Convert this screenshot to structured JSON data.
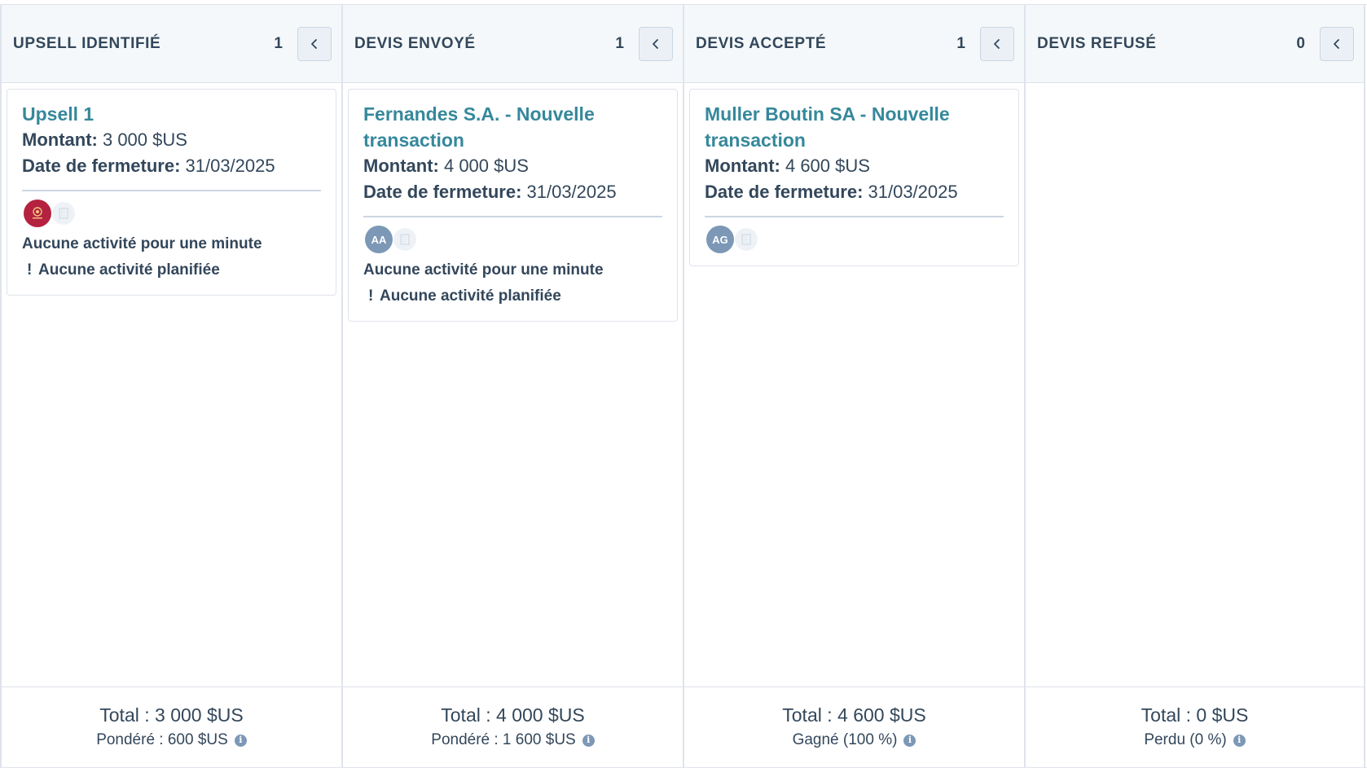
{
  "columns": [
    {
      "title": "UPSELL IDENTIFIÉ",
      "count": "1",
      "cards": [
        {
          "title": "Upsell 1",
          "amount_label": "Montant:",
          "amount": " 3 000 $US",
          "close_label": "Date de fermeture:",
          "close_date": " 31/03/2025",
          "owner": {
            "type": "logo",
            "initials": ""
          },
          "activity": "Aucune activité pour une minute",
          "planned": "Aucune activité planifiée"
        }
      ],
      "total": "Total : 3 000 $US",
      "weighted": "Pondéré : 600 $US"
    },
    {
      "title": "DEVIS ENVOYÉ",
      "count": "1",
      "cards": [
        {
          "title": "Fernandes S.A. - Nouvelle transaction",
          "amount_label": "Montant:",
          "amount": " 4 000 $US",
          "close_label": "Date de fermeture:",
          "close_date": " 31/03/2025",
          "owner": {
            "type": "initials",
            "initials": "AA"
          },
          "activity": "Aucune activité pour une minute",
          "planned": "Aucune activité planifiée"
        }
      ],
      "total": "Total : 4 000 $US",
      "weighted": "Pondéré : 1 600 $US"
    },
    {
      "title": "DEVIS ACCEPTÉ",
      "count": "1",
      "cards": [
        {
          "title": "Muller Boutin SA - Nouvelle transaction",
          "amount_label": "Montant:",
          "amount": " 4 600 $US",
          "close_label": "Date de fermeture:",
          "close_date": " 31/03/2025",
          "owner": {
            "type": "initials",
            "initials": "AG"
          },
          "activity": "",
          "planned": ""
        }
      ],
      "total": "Total : 4 600 $US",
      "weighted": "Gagné (100 %)"
    },
    {
      "title": "DEVIS REFUSÉ",
      "count": "0",
      "cards": [],
      "total": "Total : 0 $US",
      "weighted": "Perdu (0 %)"
    }
  ],
  "icons": {
    "collapse": "chevron-left-icon",
    "company": "company-building-icon",
    "info": "info-icon",
    "warning": "exclamation-icon"
  },
  "colors": {
    "link": "#36889b",
    "header_bg": "#f5f8fa",
    "border": "#dfe3eb",
    "avatar": "#7c98b6",
    "logo_avatar": "#b4223f"
  }
}
